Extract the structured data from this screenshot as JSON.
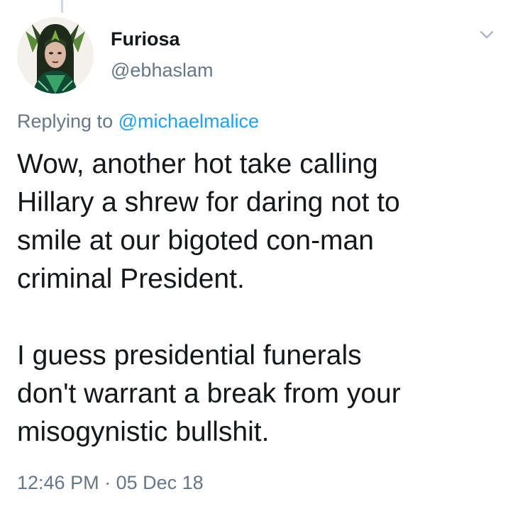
{
  "tweet": {
    "author": {
      "display_name": "Furiosa",
      "handle": "@ebhaslam",
      "avatar_icon": "profile-photo"
    },
    "menu_icon": "chevron-down-icon",
    "reply": {
      "prefix": "Replying to",
      "mention": "@michaelmalice"
    },
    "paragraphs": [
      [
        "Wow, another hot take calling",
        "Hillary a shrew for daring not to",
        "smile at our bigoted con-man",
        "criminal President."
      ],
      [
        "I guess presidential funerals",
        "don't warrant a break from your",
        "misogynistic bullshit."
      ]
    ],
    "timestamp": {
      "time": "12:46 PM",
      "separator": "·",
      "date": "05 Dec 18"
    }
  },
  "colors": {
    "text_primary": "#14171a",
    "text_secondary": "#657786",
    "link": "#1da1f2",
    "thread_line": "#ccd6dd"
  }
}
